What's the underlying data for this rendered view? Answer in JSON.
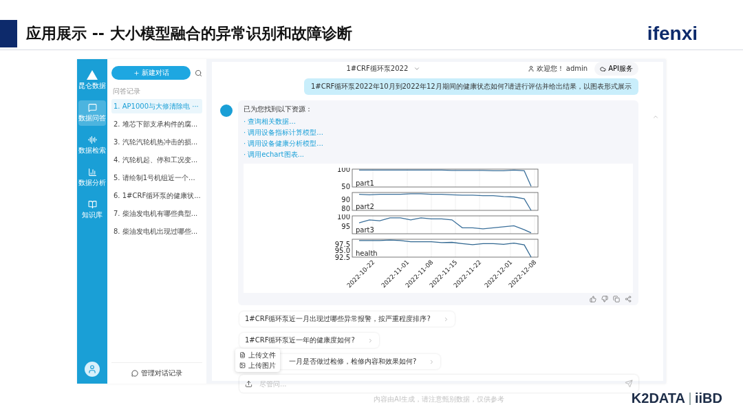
{
  "slide": {
    "title": "应用展示 -- 大小模型融合的异常识别和故障诊断",
    "logo": "ifenxi",
    "footer_logos": [
      "K2DATA",
      "iiBD"
    ]
  },
  "app": {
    "nav": {
      "brand": "昆仑数据",
      "items": [
        {
          "label": "数据问答",
          "selected": true
        },
        {
          "label": "数据检索",
          "selected": false
        },
        {
          "label": "数据分析",
          "selected": false
        },
        {
          "label": "知识库",
          "selected": false
        }
      ]
    },
    "history": {
      "new_button": "新建对话",
      "section_label": "问答记录",
      "items": [
        {
          "label": "1. AP1000与大修清除电 ···",
          "selected": true
        },
        {
          "label": "2. 堆芯下部支承构件的腐...",
          "selected": false
        },
        {
          "label": "3. 汽轮汽轮机热冲击的损...",
          "selected": false
        },
        {
          "label": "4. 汽轮机起、停和工况变...",
          "selected": false
        },
        {
          "label": "5. 请绘制1号机组近一个...",
          "selected": false
        },
        {
          "label": "6. 1#CRF循环泵的健康状...",
          "selected": false
        },
        {
          "label": "7. 柴油发电机有哪些典型...",
          "selected": false
        },
        {
          "label": "8. 柴油发电机出现过哪些...",
          "selected": false
        }
      ],
      "manage_button": "管理对话记录"
    },
    "header": {
      "device_select": "1#CRF循环泵2022",
      "welcome": "欢迎您！ admin",
      "api_button": "API服务"
    },
    "user_message": "1#CRF循环泵2022年10月到2022年12月期间的健康状态如何?请进行评估并给出结果，以图表形式展示",
    "reply": {
      "intro": "已为您找到以下资源：",
      "resources": [
        "· 查询相关数据...",
        "· 调用设备指标计算模型...",
        "· 调用设备健康分析模型...",
        "· 调用echart图表..."
      ],
      "chart_panels": [
        {
          "chart_data": {
            "type": "line",
            "x": [
              "2022-10-18",
              "2022-10-21",
              "2022-10-24",
              "2022-10-27",
              "2022-10-30",
              "2022-11-02",
              "2022-11-05",
              "2022-11-08",
              "2022-11-11",
              "2022-11-14",
              "2022-11-17",
              "2022-11-20",
              "2022-11-23",
              "2022-11-26",
              "2022-11-29",
              "2022-12-02",
              "2022-12-05",
              "2022-12-07"
            ],
            "xlim": [
              "2022-10-16",
              "2022-12-09"
            ],
            "ylim": [
              48,
              102
            ],
            "yticks": [
              {
                "value": 50,
                "label": "50"
              },
              {
                "value": 100,
                "label": "100"
              }
            ],
            "grid": true,
            "series": [
              {
                "name": "part1",
                "color": "#3a6f9a",
                "values": [
                  99,
                  99,
                  99,
                  99,
                  99,
                  99,
                  99,
                  99,
                  99,
                  98,
                  98,
                  98,
                  98,
                  97,
                  97,
                  99,
                  97,
                  50
                ]
              }
            ]
          }
        },
        {
          "chart_data": {
            "type": "line",
            "x": [
              "2022-10-18",
              "2022-10-21",
              "2022-10-24",
              "2022-10-27",
              "2022-10-30",
              "2022-11-02",
              "2022-11-05",
              "2022-11-08",
              "2022-11-11",
              "2022-11-14",
              "2022-11-17",
              "2022-11-20",
              "2022-11-23",
              "2022-11-26",
              "2022-11-29",
              "2022-12-02",
              "2022-12-05",
              "2022-12-07"
            ],
            "xlim": [
              "2022-10-16",
              "2022-12-09"
            ],
            "ylim": [
              78,
              98
            ],
            "yticks": [
              {
                "value": 80,
                "label": "80"
              },
              {
                "value": 90,
                "label": "90"
              }
            ],
            "grid": true,
            "series": [
              {
                "name": "part2",
                "color": "#3a6f9a",
                "values": [
                  96,
                  95.5,
                  96,
                  96,
                  96,
                  96.5,
                  96.5,
                  96,
                  96,
                  95.5,
                  95,
                  95,
                  94.5,
                  94.5,
                  93.5,
                  93,
                  91,
                  78
                ]
              }
            ]
          }
        },
        {
          "chart_data": {
            "type": "line",
            "x": [
              "2022-10-18",
              "2022-10-21",
              "2022-10-24",
              "2022-10-27",
              "2022-10-30",
              "2022-11-02",
              "2022-11-05",
              "2022-11-08",
              "2022-11-11",
              "2022-11-14",
              "2022-11-17",
              "2022-11-20",
              "2022-11-23",
              "2022-11-26",
              "2022-11-29",
              "2022-12-02",
              "2022-12-05",
              "2022-12-07"
            ],
            "xlim": [
              "2022-10-16",
              "2022-12-09"
            ],
            "ylim": [
              91.5,
              100.5
            ],
            "yticks": [
              {
                "value": 95,
                "label": "95"
              },
              {
                "value": 100,
                "label": "100"
              }
            ],
            "grid": true,
            "series": [
              {
                "name": "part3",
                "color": "#3a6f9a",
                "values": [
                  97,
                  98.5,
                  98,
                  99.5,
                  99.5,
                  98.5,
                  99.5,
                  99,
                  99,
                  98.5,
                  94.5,
                  94.5,
                  94,
                  94.5,
                  95,
                  95.5,
                  93.5,
                  92
                ]
              }
            ]
          }
        },
        {
          "chart_data": {
            "type": "line",
            "x": [
              "2022-10-18",
              "2022-10-21",
              "2022-10-24",
              "2022-10-27",
              "2022-10-30",
              "2022-11-02",
              "2022-11-05",
              "2022-11-08",
              "2022-11-11",
              "2022-11-14",
              "2022-11-17",
              "2022-11-20",
              "2022-11-23",
              "2022-11-26",
              "2022-11-29",
              "2022-12-02",
              "2022-12-05",
              "2022-12-07"
            ],
            "xlim": [
              "2022-10-16",
              "2022-12-09"
            ],
            "ylim": [
              92.5,
              99.5
            ],
            "yticks": [
              {
                "value": 92.5,
                "label": "92.5"
              },
              {
                "value": 95,
                "label": "95.0"
              },
              {
                "value": 97.5,
                "label": "97.5"
              }
            ],
            "grid": true,
            "xticks": [
              "2022-10-22",
              "2022-11-01",
              "2022-11-08",
              "2022-11-15",
              "2022-11-22",
              "2022-12-01",
              "2022-12-08"
            ],
            "series": [
              {
                "name": "health",
                "color": "#2f6690",
                "values": [
                  99,
                  99,
                  99,
                  99.2,
                  99,
                  98.5,
                  98.5,
                  98.5,
                  98.2,
                  98.3,
                  97.8,
                  97.4,
                  97.8,
                  97.8,
                  97.5,
                  98,
                  97.3,
                  92.5
                ]
              }
            ]
          }
        }
      ]
    },
    "suggestions": [
      "1#CRF循环泵近一月出现过哪些异常报警，按严重程度排序?",
      "1#CRF循环泵近一年的健康度如何?",
      "一月是否做过检修，检修内容和效果如何?"
    ],
    "upload_menu": [
      "上传文件",
      "上传图片"
    ],
    "input": {
      "placeholder": "尽管问..."
    },
    "disclaimer": "内容由AI生成，请注意甄别数据，仅供参考"
  }
}
